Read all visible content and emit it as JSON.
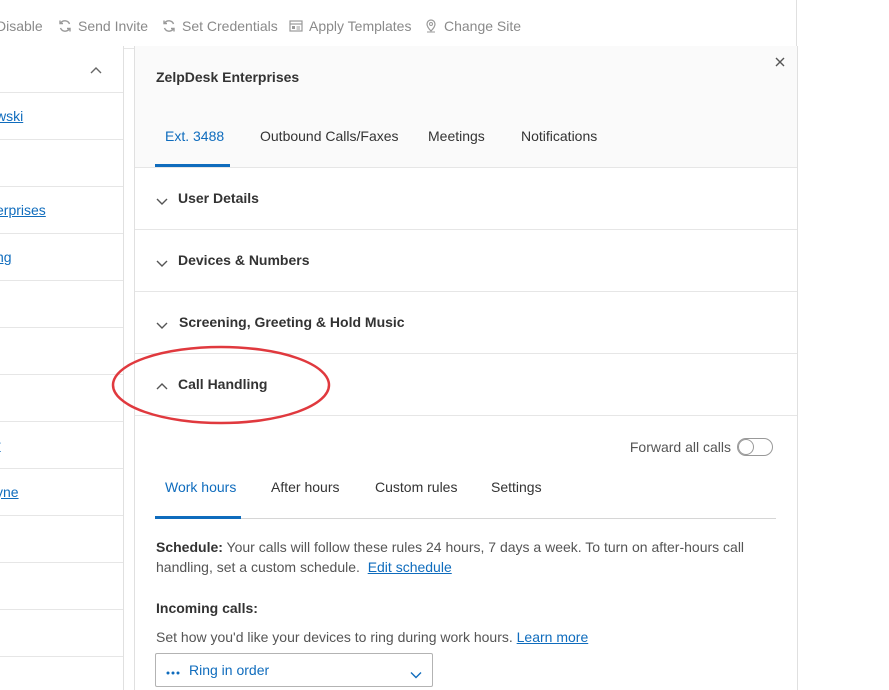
{
  "toolbar": {
    "items": [
      {
        "label": "Disable",
        "icon": "disable-icon"
      },
      {
        "label": "Send Invite",
        "icon": "refresh-icon"
      },
      {
        "label": "Set Credentials",
        "icon": "refresh-icon"
      },
      {
        "label": "Apply Templates",
        "icon": "template-icon"
      },
      {
        "label": "Change Site",
        "icon": "location-pin-icon"
      }
    ]
  },
  "user_list": {
    "header_icon": "chevron-up-icon",
    "rows": [
      {
        "label": "wski"
      },
      {
        "label": ""
      },
      {
        "label": "erprises"
      },
      {
        "label": "ng"
      },
      {
        "label": ""
      },
      {
        "label": ""
      },
      {
        "label": ""
      },
      {
        "label": "r"
      },
      {
        "label": "yne"
      },
      {
        "label": ""
      },
      {
        "label": ""
      },
      {
        "label": ""
      }
    ]
  },
  "details": {
    "title": "ZelpDesk Enterprises",
    "close_icon": "close-icon",
    "tabs": [
      {
        "label": "Ext. 3488",
        "active": true
      },
      {
        "label": "Outbound Calls/Faxes",
        "active": false
      },
      {
        "label": "Meetings",
        "active": false
      },
      {
        "label": "Notifications",
        "active": false
      }
    ],
    "sections": [
      {
        "label": "User Details",
        "expanded": false
      },
      {
        "label": "Devices & Numbers",
        "expanded": false
      },
      {
        "label": "Screening, Greeting & Hold Music",
        "expanded": false
      },
      {
        "label": "Call Handling",
        "expanded": true
      }
    ],
    "call_handling": {
      "forward_all_label": "Forward all calls",
      "forward_all_on": false,
      "subtabs": [
        {
          "label": "Work hours",
          "active": true
        },
        {
          "label": "After hours",
          "active": false
        },
        {
          "label": "Custom rules",
          "active": false
        },
        {
          "label": "Settings",
          "active": false
        }
      ],
      "schedule_label": "Schedule:",
      "schedule_text": "Your calls will follow these rules 24 hours, 7 days a week. To turn on after-hours call handling, set a custom schedule.",
      "edit_schedule_link": "Edit schedule",
      "incoming_calls_label": "Incoming calls:",
      "incoming_text": "Set how you'd like your devices to ring during work hours.",
      "learn_more_link": "Learn more",
      "ring_select_value": "Ring in order",
      "ring_select_icon": "dots-icon"
    }
  },
  "colors": {
    "accent": "#0f6cbd",
    "annotation": "#e0393e"
  }
}
